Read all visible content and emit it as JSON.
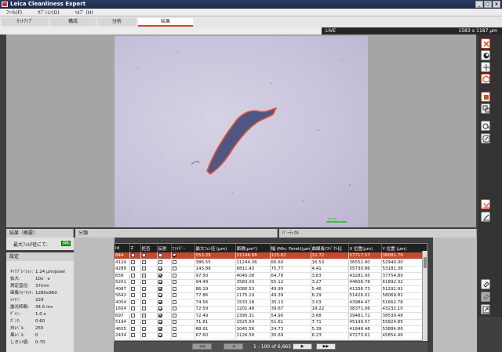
{
  "window": {
    "title": "Leica Cleanliness Expert",
    "buttons": [
      "_",
      "□",
      "×"
    ]
  },
  "menu": {
    "items": [
      "ﾌｧｲﾙ(F)",
      "ｵﾌﾟｼｮﾝ(O)",
      "ﾍﾙﾌﾟ (H)"
    ]
  },
  "tabs": [
    {
      "label": "ｾｯﾄｱｯﾌﾟ",
      "active": false
    },
    {
      "label": "構成",
      "active": false
    },
    {
      "label": "分析",
      "active": false
    },
    {
      "label": "結果",
      "active": true
    }
  ],
  "status": {
    "mode": "LIVE",
    "resolution": "1583 x 1187 µm"
  },
  "scale": {
    "label": "1mm"
  },
  "accent_color": "#d04a22",
  "toolbar": {
    "icons": [
      "close-icon",
      "contour-icon",
      "crosshair-icon",
      "hexagon-icon",
      "color-fill-icon",
      "layers-icon",
      "objects-icon",
      "edit-icon",
      "validate-icon",
      "measure-line-icon",
      "link-icon",
      "link-off-icon",
      "export-icon"
    ]
  },
  "summary": {
    "header": "結果（概要）",
    "label": "最大ﾌｨﾙﾀ径にて:",
    "badge": "OK",
    "badge_color": "#2fb12f"
  },
  "classification": {
    "header": "分類"
  },
  "particles": {
    "header": "ﾊﾟｰﾃｨｸﾙ"
  },
  "settings": {
    "header": "設定",
    "rows": [
      {
        "k": "ｷｬﾘﾌﾞﾚｰｼｮﾝ:",
        "v": "1.24 µm/pixel"
      },
      {
        "k": "拡大:",
        "v": "10x · x"
      },
      {
        "k": "測定直径:",
        "v": "37mm"
      },
      {
        "k": "画像ﾌｫｰﾏｯﾄ:",
        "v": "1280x960"
      },
      {
        "k": "ｼｬｱﾉ:",
        "v": "229"
      },
      {
        "k": "露光時間:",
        "v": "34.5 ms"
      },
      {
        "k": "ｹﾞｲﾝ:",
        "v": "1.0 x"
      },
      {
        "k": "ｶﾞﾝﾏ:",
        "v": "0.60"
      },
      {
        "k": "白ﾚﾍﾞﾙ:",
        "v": "255"
      },
      {
        "k": "黒ﾚﾍﾞﾙ:",
        "v": "0"
      },
      {
        "k": "しきい値:",
        "v": "0-70"
      }
    ]
  },
  "table": {
    "columns": [
      "Id",
      "Z",
      "拒否",
      "反射",
      "ﾌｧｲﾊﾞｰ",
      "最大ﾌｪﾚ径 (µm)",
      "面積(µm²)",
      "幅 (Min. Feret)(µm)",
      "曲線長ｱｽﾍﾟｸﾄ比",
      "X 位置(µm)",
      "Y 位置 (µm)"
    ],
    "rows": [
      {
        "id": "844",
        "z": false,
        "reject": false,
        "refl": false,
        "fiber": true,
        "feret": "553.25",
        "area": "31146.68",
        "width": "125.62",
        "aspect": "32.72",
        "x": "57717.57",
        "y": "38081.79"
      },
      {
        "id": "4124",
        "z": false,
        "reject": false,
        "refl": false,
        "fiber": false,
        "feret": "386.55",
        "area": "11244.36",
        "width": "66.60",
        "aspect": "16.53",
        "x": "36552.90",
        "y": "52940.00"
      },
      {
        "id": "4289",
        "z": false,
        "reject": false,
        "refl": true,
        "fiber": false,
        "feret": "143.88",
        "area": "6811.43",
        "width": "75.77",
        "aspect": "4.41",
        "x": "55730.86",
        "y": "53181.36"
      },
      {
        "id": "658",
        "z": false,
        "reject": false,
        "refl": true,
        "fiber": false,
        "feret": "97.50",
        "area": "4040.08",
        "width": "64.78",
        "aspect": "3.83",
        "x": "43281.95",
        "y": "37754.89"
      },
      {
        "id": "6201",
        "z": false,
        "reject": false,
        "refl": true,
        "fiber": false,
        "feret": "94.49",
        "area": "3583.03",
        "width": "55.12",
        "aspect": "3.27",
        "x": "44606.78",
        "y": "61892.32"
      },
      {
        "id": "4087",
        "z": false,
        "reject": false,
        "refl": true,
        "fiber": false,
        "feret": "86.19",
        "area": "2086.53",
        "width": "49.99",
        "aspect": "5.46",
        "x": "41336.73",
        "y": "51292.91"
      },
      {
        "id": "5642",
        "z": false,
        "reject": false,
        "refl": true,
        "fiber": false,
        "feret": "77.86",
        "area": "2175.19",
        "width": "49.39",
        "aspect": "6.29",
        "x": "51426.01",
        "y": "58069.82"
      },
      {
        "id": "4054",
        "z": false,
        "reject": false,
        "refl": true,
        "fiber": false,
        "feret": "74.56",
        "area": "1533.18",
        "width": "35.13",
        "aspect": "3.03",
        "x": "43984.47",
        "y": "51662.78"
      },
      {
        "id": "1654",
        "z": false,
        "reject": false,
        "refl": true,
        "fiber": false,
        "feret": "72.59",
        "area": "1201.48",
        "width": "39.67",
        "aspect": "19.22",
        "x": "38371.06",
        "y": "43232.10"
      },
      {
        "id": "697",
        "z": false,
        "reject": false,
        "refl": true,
        "fiber": false,
        "feret": "72.49",
        "area": "2395.31",
        "width": "54.90",
        "aspect": "3.68",
        "x": "39481.72",
        "y": "38539.48"
      },
      {
        "id": "5194",
        "z": false,
        "reject": false,
        "refl": true,
        "fiber": false,
        "feret": "71.81",
        "area": "1525.54",
        "width": "51.61",
        "aspect": "7.71",
        "x": "45199.57",
        "y": "55824.85"
      },
      {
        "id": "4655",
        "z": false,
        "reject": false,
        "refl": true,
        "fiber": false,
        "feret": "68.91",
        "area": "1045.56",
        "width": "24.73",
        "aspect": "5.39",
        "x": "41848.48",
        "y": "53884.80"
      },
      {
        "id": "2434",
        "z": false,
        "reject": false,
        "refl": true,
        "fiber": false,
        "feret": "67.60",
        "area": "1126.58",
        "width": "30.69",
        "aspect": "6.23",
        "x": "67273.61",
        "y": "45854.46"
      }
    ]
  },
  "pager": {
    "text": "1 - 100 of 6,665",
    "first": "◀◀",
    "prev": "◀",
    "next": "▶",
    "last": "▶▶"
  }
}
